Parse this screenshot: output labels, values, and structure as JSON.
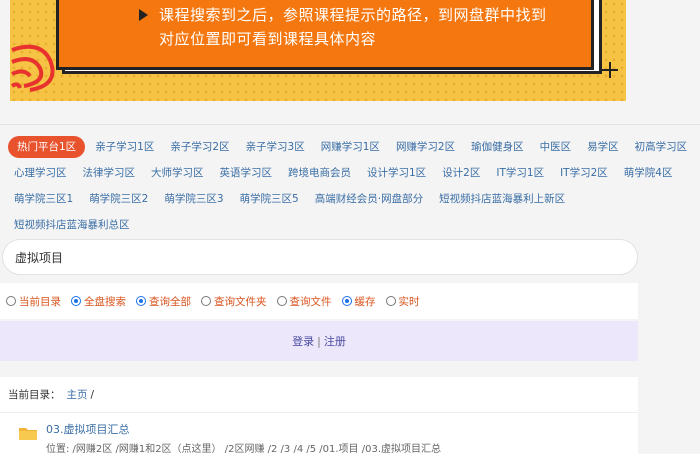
{
  "banner": {
    "text": "课程搜索到之后，参照课程提示的路径，到网盘群中找到对应位置即可看到课程具体内容"
  },
  "tags": [
    "热门平台1区",
    "亲子学习1区",
    "亲子学习2区",
    "亲子学习3区",
    "网赚学习1区",
    "网赚学习2区",
    "瑜伽健身区",
    "中医区",
    "易学区",
    "初高学习区",
    "心理学习区",
    "法律学习区",
    "大师学习区",
    "英语学习区",
    "跨境电商会员",
    "设计学习1区",
    "设计2区",
    "IT学习1区",
    "IT学习2区",
    "萌学院4区",
    "萌学院三区1",
    "萌学院三区2",
    "萌学院三区3",
    "萌学院三区5",
    "高端财经会员·网盘部分",
    "短视频抖店蓝海暴利上新区",
    "短视频抖店蓝海暴利总区"
  ],
  "search": {
    "value": "虚拟项目"
  },
  "options": [
    {
      "label": "当前目录",
      "checked": false
    },
    {
      "label": "全盘搜索",
      "checked": true
    },
    {
      "label": "查询全部",
      "checked": true
    },
    {
      "label": "查询文件夹",
      "checked": false
    },
    {
      "label": "查询文件",
      "checked": false
    },
    {
      "label": "缓存",
      "checked": true
    },
    {
      "label": "实时",
      "checked": false
    }
  ],
  "login": {
    "login_label": "登录",
    "separator": "|",
    "register_label": "注册"
  },
  "panel": {
    "current_dir_label": "当前目录：",
    "home_label": "主页",
    "path_sep": "/",
    "file_name": "03.虚拟项目汇总",
    "file_location": "位置: /网赚2区 /网赚1和2区（点这里） /2区网赚 /2 /3 /4 /5 /01.项目 /03.虚拟项目汇总"
  },
  "colors": {
    "accent": "#e8522d",
    "link": "#3a6ea5",
    "banner_orange": "#f5770f",
    "banner_yellow": "#f6c344",
    "login_bg": "#ece7fb"
  }
}
